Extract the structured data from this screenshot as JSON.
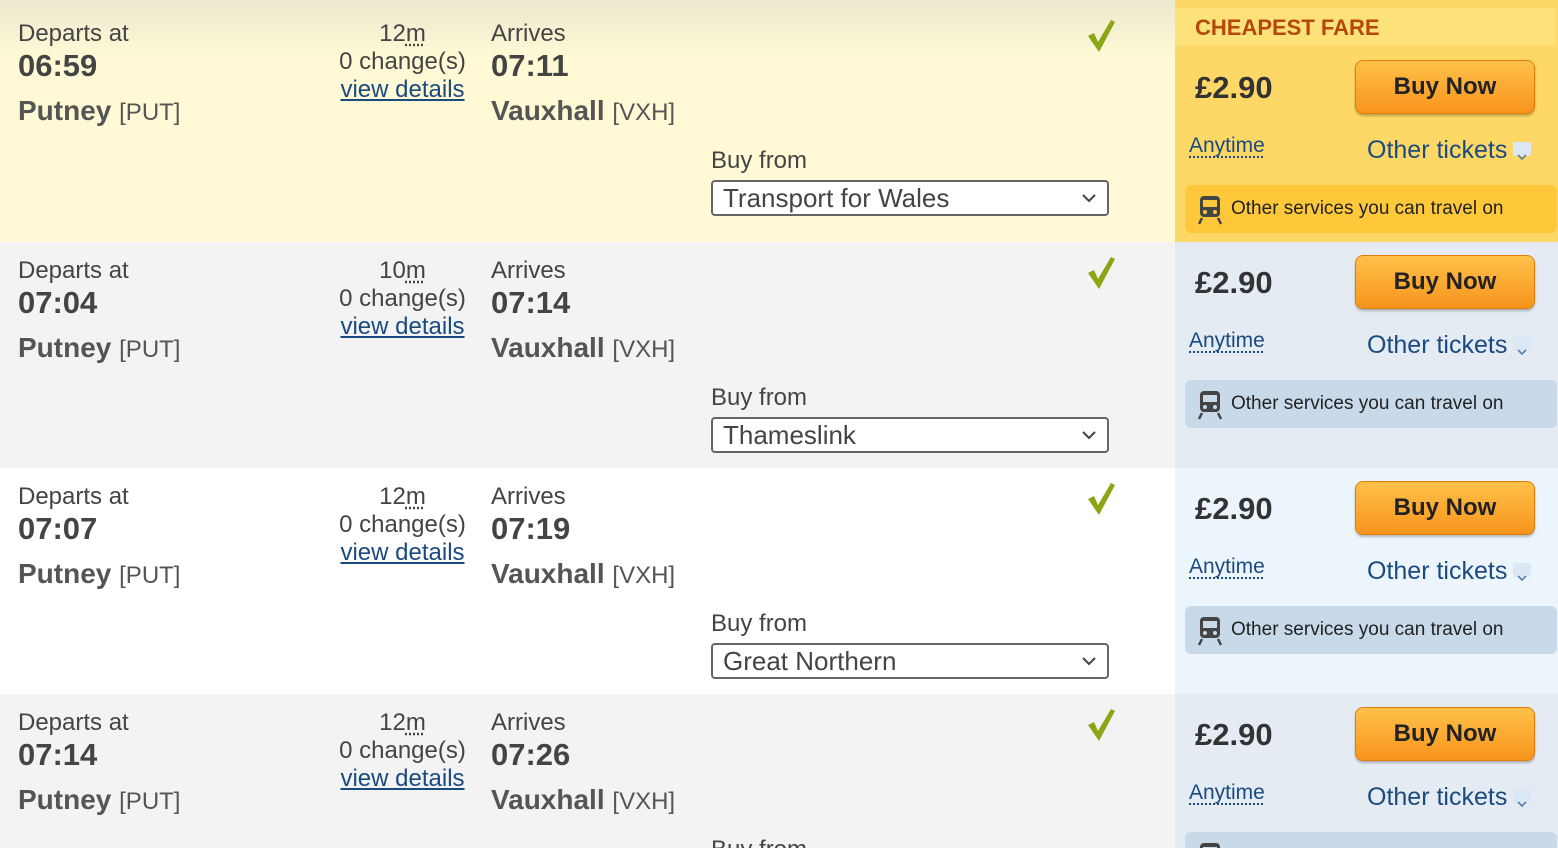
{
  "labels": {
    "departs": "Departs at",
    "arrives": "Arrives",
    "buy_from": "Buy from",
    "view_details": "view details",
    "cheapest": "CHEAPEST FARE",
    "buy_now": "Buy Now",
    "other_tickets": "Other tickets",
    "services": "Other services you can travel on"
  },
  "colors": {
    "highlight_row": "#fffad5",
    "highlight_fare": "#fed867",
    "grey_row": "#f3f3f3",
    "white_row": "#ffffff",
    "fare_panel_a": "#e4ebf3",
    "fare_panel_b": "#edf5fc",
    "services_box": "#c8d9ea",
    "services_box_cheap": "#fec83a",
    "check_green": "#8aa614",
    "link_blue": "#1a4a80",
    "cheapest_text": "#b4480e"
  },
  "journeys": [
    {
      "dep_time": "06:59",
      "dep_station": "Putney",
      "dep_code": "[PUT]",
      "duration": "12",
      "duration_unit": "m",
      "changes": "0 change(s)",
      "arr_time": "07:11",
      "arr_station": "Vauxhall",
      "arr_code": "[VXH]",
      "operator": "Transport for Wales",
      "price": "£2.90",
      "fare_type": "Anytime",
      "cheapest": true
    },
    {
      "dep_time": "07:04",
      "dep_station": "Putney",
      "dep_code": "[PUT]",
      "duration": "10",
      "duration_unit": "m",
      "changes": "0 change(s)",
      "arr_time": "07:14",
      "arr_station": "Vauxhall",
      "arr_code": "[VXH]",
      "operator": "Thameslink",
      "price": "£2.90",
      "fare_type": "Anytime",
      "cheapest": false
    },
    {
      "dep_time": "07:07",
      "dep_station": "Putney",
      "dep_code": "[PUT]",
      "duration": "12",
      "duration_unit": "m",
      "changes": "0 change(s)",
      "arr_time": "07:19",
      "arr_station": "Vauxhall",
      "arr_code": "[VXH]",
      "operator": "Great Northern",
      "price": "£2.90",
      "fare_type": "Anytime",
      "cheapest": false
    },
    {
      "dep_time": "07:14",
      "dep_station": "Putney",
      "dep_code": "[PUT]",
      "duration": "12",
      "duration_unit": "m",
      "changes": "0 change(s)",
      "arr_time": "07:26",
      "arr_station": "Vauxhall",
      "arr_code": "[VXH]",
      "operator": "",
      "price": "£2.90",
      "fare_type": "Anytime",
      "cheapest": false
    }
  ],
  "icons": {
    "check": "checkmark-icon",
    "train": "train-icon",
    "chevron": "chevron-down-icon"
  }
}
